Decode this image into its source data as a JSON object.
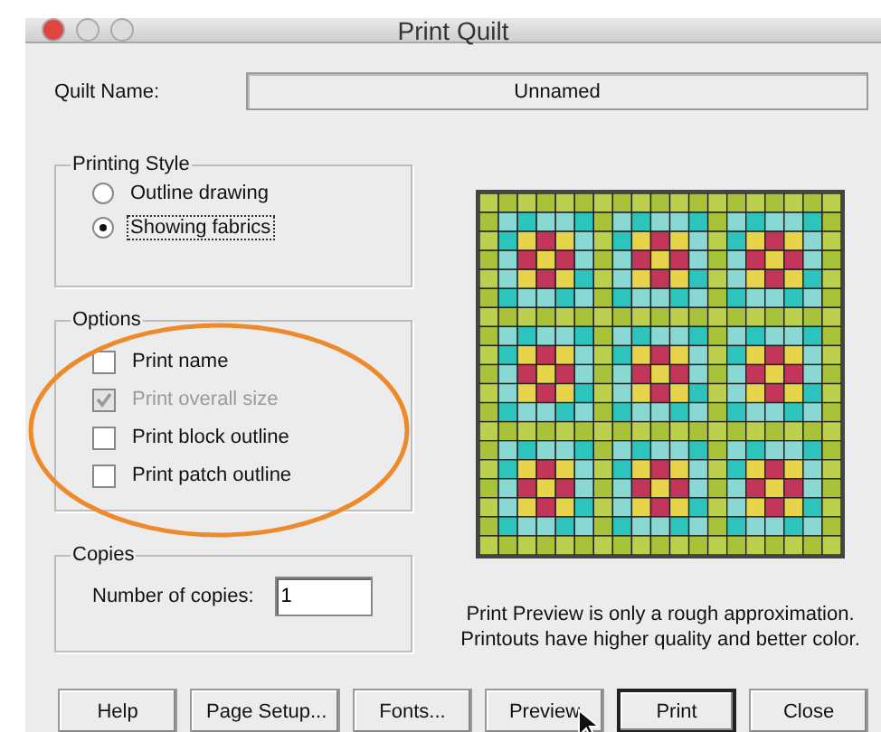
{
  "window": {
    "title": "Print Quilt"
  },
  "quilt_name": {
    "label": "Quilt Name:",
    "value": "Unnamed"
  },
  "printing_style": {
    "title": "Printing Style",
    "options": [
      {
        "label": "Outline drawing",
        "selected": false
      },
      {
        "label": "Showing fabrics",
        "selected": true
      }
    ]
  },
  "options": {
    "title": "Options",
    "items": [
      {
        "label": "Print name",
        "checked": false,
        "disabled": false
      },
      {
        "label": "Print overall size",
        "checked": true,
        "disabled": true
      },
      {
        "label": "Print block outline",
        "checked": false,
        "disabled": false
      },
      {
        "label": "Print patch outline",
        "checked": false,
        "disabled": false
      }
    ]
  },
  "copies": {
    "title": "Copies",
    "label": "Number of copies:",
    "value": "1"
  },
  "preview_note": [
    "Print Preview is only a rough approximation.",
    "Printouts have higher quality and better color."
  ],
  "buttons": [
    {
      "label": "Help",
      "default": false
    },
    {
      "label": "Page Setup...",
      "default": false
    },
    {
      "label": "Fonts...",
      "default": false
    },
    {
      "label": "Preview",
      "default": false
    },
    {
      "label": "Print",
      "default": true
    },
    {
      "label": "Close",
      "default": false
    }
  ]
}
